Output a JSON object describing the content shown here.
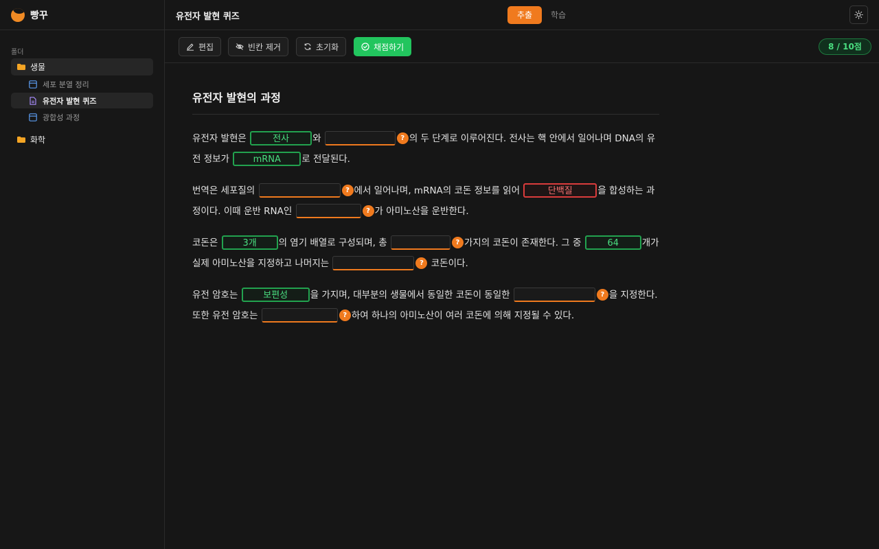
{
  "app": {
    "name": "빵꾸"
  },
  "sidebar": {
    "caption": "폴더",
    "folders": [
      {
        "label": "생물",
        "files": [
          {
            "label": "세포 분열 정리"
          },
          {
            "label": "유전자 발현 퀴즈"
          },
          {
            "label": "광합성 과정"
          }
        ]
      },
      {
        "label": "화학"
      }
    ]
  },
  "header": {
    "title": "유전자 발현 퀴즈",
    "tabs": [
      {
        "label": "추출"
      },
      {
        "label": "학습"
      }
    ],
    "theme_icon": "sun-icon"
  },
  "toolbar": {
    "edit_label": "편집",
    "hide_blanks_label": "빈칸 제거",
    "reset_label": "초기화",
    "grade_label": "채점하기",
    "score": "8 / 10점"
  },
  "document": {
    "title": "유전자 발현의 과정",
    "p1": {
      "t1": "유전자 발현은 ",
      "b1": "전사",
      "t2": "와 ",
      "t3": "의 두 단계로 이루어진다. 전사는 핵 안에서 일어나며 DNA의 유전 정보가 ",
      "b3": "mRNA",
      "t4": "로 전달된다."
    },
    "p2": {
      "t1": "번역은 세포질의 ",
      "t2": "에서 일어나며, mRNA의 코돈 정보를 읽어 ",
      "b2": "단백질",
      "t3": "을 합성하는 과정이다. 이때 운반 RNA인 ",
      "t4": "가 아미노산을 운반한다."
    },
    "p3": {
      "t1": "코돈은 ",
      "b1": "3개",
      "t2": "의 염기 배열로 구성되며, 총 ",
      "t3": "가지의 코돈이 존재한다. 그 중 ",
      "b3": "64",
      "t4": "개가 실제 아미노산을 지정하고 나머지는 ",
      "t5": " 코돈이다."
    },
    "p4": {
      "t1": "유전 암호는 ",
      "b1": "보편성",
      "t2": "을 가지며, 대부분의 생물에서 동일한 코돈이 동일한 ",
      "t3": "을 지정한다. 또한 유전 암호는 ",
      "t4": "하여 하나의 아미노산이 여러 코돈에 의해 지정될 수 있다."
    },
    "hint_symbol": "?"
  },
  "colors": {
    "accent": "#f07a1e",
    "correct": "#22c55e",
    "wrong": "#dc3c3c"
  }
}
